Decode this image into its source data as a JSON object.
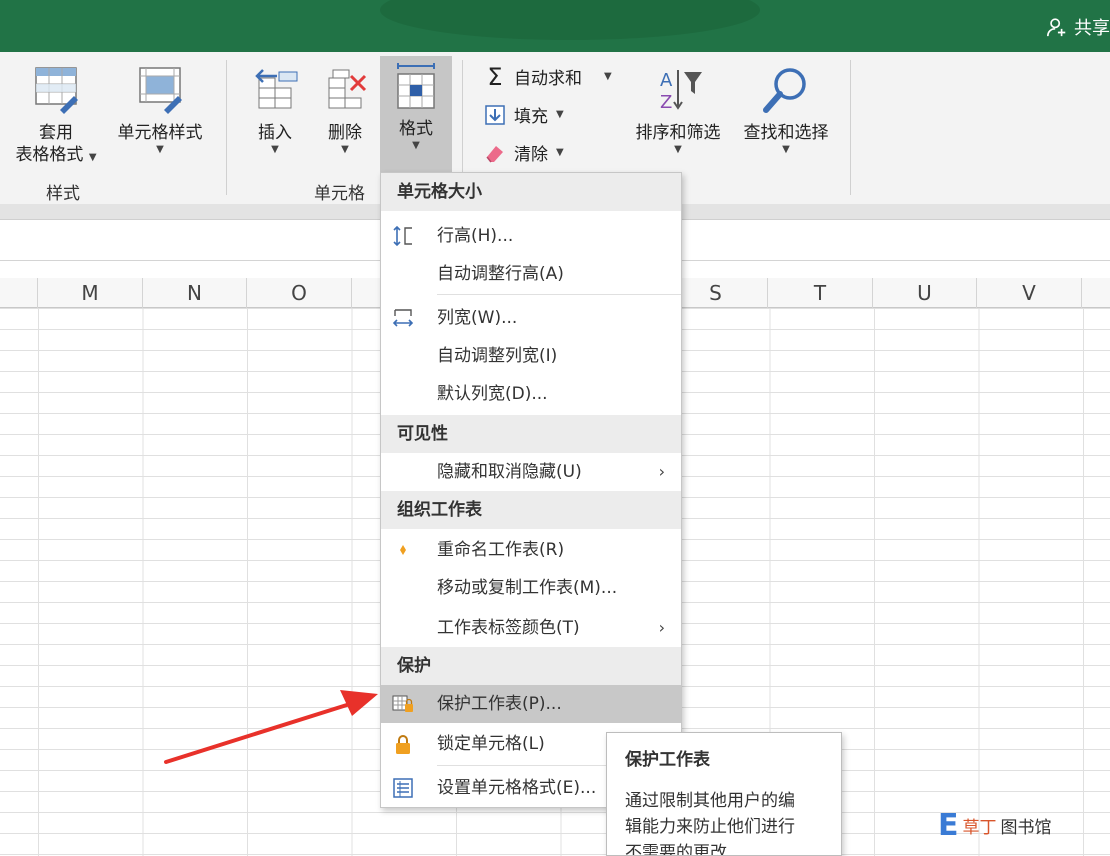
{
  "titlebar": {
    "share_label": "共享"
  },
  "ribbon": {
    "styles_group": {
      "label": "样式",
      "table_format": {
        "line1": "套用",
        "line2": "表格格式"
      },
      "cell_styles": {
        "label": "单元格样式"
      }
    },
    "cells_group": {
      "label": "单元格",
      "insert": "插入",
      "delete": "删除",
      "format": "格式"
    },
    "editing_group": {
      "autosum": "自动求和",
      "fill": "填充",
      "clear": "清除",
      "sort_filter": "排序和筛选",
      "find_select": "查找和选择"
    }
  },
  "columns": [
    "M",
    "N",
    "O",
    "S",
    "T",
    "U",
    "V"
  ],
  "menu": {
    "sections": [
      {
        "header": "单元格大小",
        "items": [
          {
            "label": "行高(H)...",
            "icon": "row-height-icon"
          },
          {
            "label": "自动调整行高(A)"
          },
          {
            "label": "列宽(W)...",
            "icon": "column-width-icon"
          },
          {
            "label": "自动调整列宽(I)"
          },
          {
            "label": "默认列宽(D)..."
          }
        ]
      },
      {
        "header": "可见性",
        "items": [
          {
            "label": "隐藏和取消隐藏(U)",
            "submenu": true
          }
        ]
      },
      {
        "header": "组织工作表",
        "items": [
          {
            "label": "重命名工作表(R)",
            "icon": "rename-icon"
          },
          {
            "label": "移动或复制工作表(M)..."
          },
          {
            "label": "工作表标签颜色(T)",
            "submenu": true
          }
        ]
      },
      {
        "header": "保护",
        "items": [
          {
            "label": "保护工作表(P)...",
            "icon": "protect-sheet-icon",
            "highlighted": true
          },
          {
            "label": "锁定单元格(L)",
            "icon": "lock-icon"
          },
          {
            "label": "设置单元格格式(E)...",
            "icon": "format-cells-icon"
          }
        ]
      }
    ]
  },
  "tooltip": {
    "title": "保护工作表",
    "line1": "通过限制其他用户的编",
    "line2": "辑能力来防止他们进行",
    "line3": "不需要的更改"
  },
  "watermark": {
    "logo": "E",
    "name_a": "草丁",
    "name_b": "图书馆"
  },
  "colors": {
    "title_bar": "#217346",
    "ribbon": "#f3f3f3",
    "highlight": "#c8c8c8",
    "arrow": "#e8312a"
  }
}
